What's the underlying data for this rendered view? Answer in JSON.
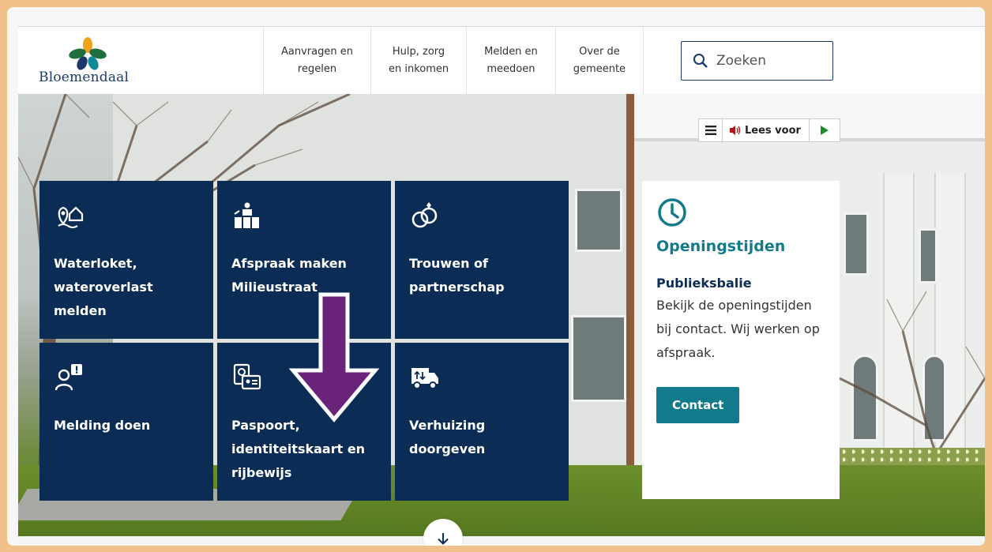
{
  "brand": {
    "name": "Bloemendaal"
  },
  "nav": {
    "items": [
      {
        "line1": "Aanvragen en",
        "line2": "regelen"
      },
      {
        "line1": "Hulp, zorg",
        "line2": "en inkomen"
      },
      {
        "line1": "Melden en",
        "line2": "meedoen"
      },
      {
        "line1": "Over de",
        "line2": "gemeente"
      }
    ]
  },
  "search": {
    "placeholder": "Zoeken"
  },
  "reader": {
    "label": "Lees voor"
  },
  "tiles": [
    {
      "icon": "water-location-icon",
      "label": "Waterloket, wateroverlast melden"
    },
    {
      "icon": "recycling-containers-icon",
      "label": "Afspraak maken Milieustraat"
    },
    {
      "icon": "rings-icon",
      "label": "Trouwen of partnerschap"
    },
    {
      "icon": "person-report-icon",
      "label": "Melding doen"
    },
    {
      "icon": "id-documents-icon",
      "label": "Paspoort, identiteitskaart en rijbewijs"
    },
    {
      "icon": "moving-truck-icon",
      "label": "Verhuizing doorgeven"
    }
  ],
  "opening": {
    "title": "Openingstijden",
    "subtitle": "Publieksbalie",
    "text": "Bekijk de openingstijden bij contact. Wij werken op afspraak.",
    "button": "Contact"
  },
  "colors": {
    "tile": "#0b2d55",
    "accent": "#137a8b",
    "arrow": "#6b2279",
    "frame": "#f2c08a"
  }
}
